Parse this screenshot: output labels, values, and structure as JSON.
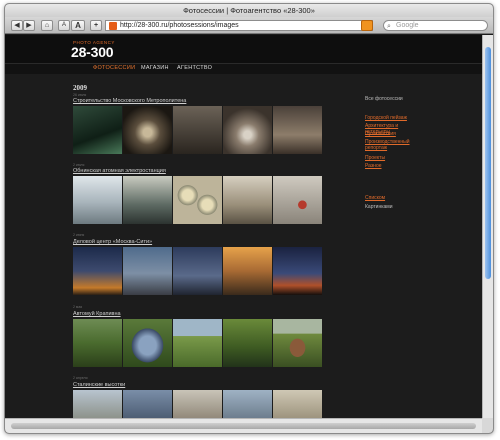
{
  "window": {
    "title": "Фотосессии | Фотоагентство «28-300»"
  },
  "toolbar": {
    "url": "http://28-300.ru/photosessions/images",
    "search_placeholder": "Google",
    "font_small_label": "A",
    "font_large_label": "A",
    "add_label": "+"
  },
  "site": {
    "logo_small": "PHOTO AGENCY",
    "logo_big": "28-300",
    "nav": [
      "ФОТОСЕССИИ",
      "МАГАЗИН",
      "АГЕНТСТВО"
    ],
    "active_nav": "ФОТОСЕССИИ",
    "accent_color": "#e8752f"
  },
  "main": {
    "year": "2009",
    "galleries": [
      {
        "date": "26 июля",
        "title": "Строительство Московского Метрополитена"
      },
      {
        "date": "2 июля",
        "title": "Обнинская атомная электростанция"
      },
      {
        "date": "2 июня",
        "title": "Деловой центр «Москва-Сити»"
      },
      {
        "date": "2 мая",
        "title": "Автомуй Крапивна"
      },
      {
        "date": "2 апреля",
        "title": "Сталинские высотки"
      }
    ]
  },
  "sidebar": {
    "all_label": "Все фотосессии",
    "categories": [
      "Городской пейзаж",
      "Архитектура и интерьеры",
      "Путешествия",
      "Производственный репортаж",
      "Проекты",
      "Разное"
    ],
    "view_list": "Списком",
    "view_pictures": "Картинками"
  }
}
